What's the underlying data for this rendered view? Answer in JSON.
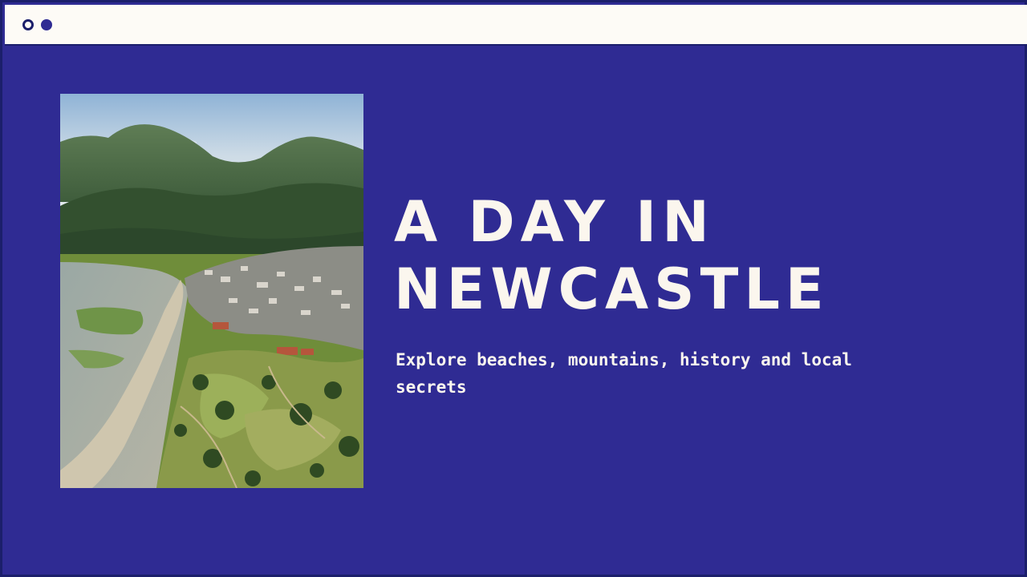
{
  "window": {
    "controls": [
      "outline-dot-icon",
      "filled-dot-icon"
    ]
  },
  "hero": {
    "headline_line1": "A DAY IN",
    "headline_line2": "NEWCASTLE",
    "subtitle": "Explore beaches, mountains, history and local secrets"
  },
  "colors": {
    "background": "#2f2b93",
    "border": "#1b1f6b",
    "titlebar": "#fdfbf6",
    "text": "#fbf6ee"
  }
}
